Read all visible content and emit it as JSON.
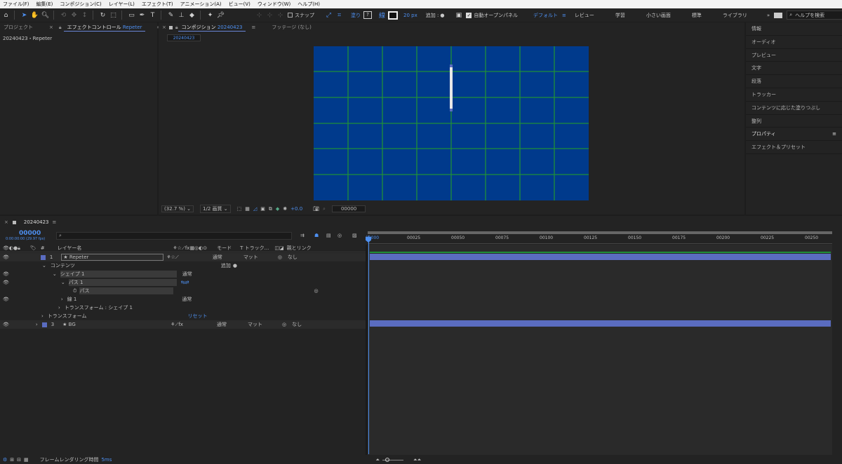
{
  "menu": [
    "ファイル(F)",
    "編集(E)",
    "コンポジション(C)",
    "レイヤー(L)",
    "エフェクト(T)",
    "アニメーション(A)",
    "ビュー(V)",
    "ウィンドウ(W)",
    "ヘルプ(H)"
  ],
  "toolbar": {
    "snap": "スナップ",
    "fill": "塗り",
    "stroke_px": "20 px",
    "add": "追加 :",
    "auto_open": "自動オープンパネル",
    "workspaces": [
      "デフォルト",
      "レビュー",
      "学習",
      "小さい画面",
      "標準",
      "ライブラリ"
    ],
    "search_placeholder": "ヘルプを検索"
  },
  "left_panel": {
    "tab_project": "プロジェクト",
    "tab_effect": "エフェクトコントロール",
    "tab_effect_target": "Repeter",
    "path": "20240423・Repeter"
  },
  "comp_panel": {
    "tab": "コンポジション",
    "tab_name": "20240423",
    "footage_tab": "フッテージ (なし)",
    "comp_chip": "20240423",
    "zoom": "(32.7 %)",
    "resolution": "1/2 画質",
    "exposure": "+0.0",
    "timecode": "00000"
  },
  "right_panel": {
    "items": [
      "情報",
      "オーディオ",
      "プレビュー",
      "文字",
      "段落",
      "トラッカー",
      "コンテンツに応じた塗りつぶし",
      "整列",
      "プロパティ",
      "エフェクト＆プリセット"
    ]
  },
  "timeline": {
    "tab": "20240423",
    "time": "00000",
    "time_sub": "0:00:00:00 (29.97 fps)",
    "col_layername": "レイヤー名",
    "col_mode": "モード",
    "col_track": "T トラック...",
    "col_parent": "親とリンク",
    "col_num": "#",
    "ruler": [
      "00000",
      "00025",
      "00050",
      "00075",
      "00100",
      "00125",
      "00150",
      "00175",
      "00200",
      "00225",
      "00250"
    ],
    "rows": [
      {
        "num": "1",
        "name": "★ Repeter",
        "mode": "通常",
        "matte": "マット",
        "parent": "なし"
      },
      {
        "name": "コンテンツ",
        "add": "追加"
      },
      {
        "name": "シェイプ 1",
        "mode": "通常"
      },
      {
        "name": "パス 1"
      },
      {
        "name": "パス"
      },
      {
        "name": "線 1",
        "mode": "通常"
      },
      {
        "name": "トランスフォーム : シェイプ 1"
      },
      {
        "name": "トランスフォーム",
        "reset": "リセット"
      },
      {
        "num": "3",
        "name": "★ BG",
        "mode": "通常",
        "matte": "マット",
        "parent": "なし"
      }
    ]
  },
  "status": {
    "label": "フレームレンダリング時間",
    "value": "5ms"
  },
  "colors": {
    "canvas": "#003a8c",
    "grid": "#1f8f3a",
    "accent": "#4d8ff0",
    "layer_bar": "#5a6cc0"
  }
}
